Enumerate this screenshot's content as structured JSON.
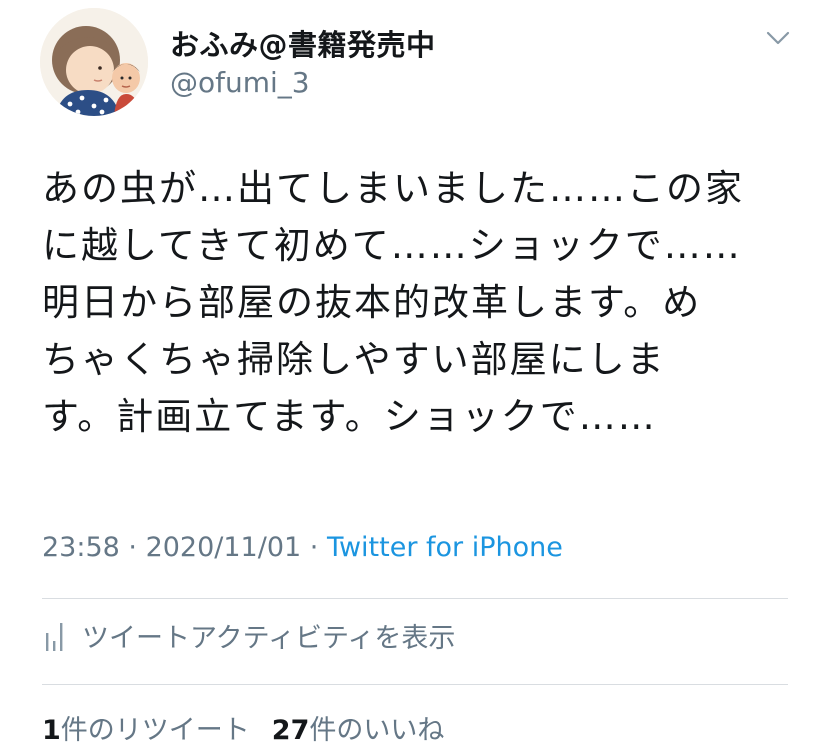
{
  "user": {
    "display_name": "おふみ@書籍発売中",
    "handle": "@ofumi_3"
  },
  "icons": {
    "avatar": "avatar-illustration",
    "menu": "chevron-down-icon",
    "activity": "analytics-bars-icon"
  },
  "tweet": {
    "lines": [
      "あの虫が…出てしまいました……この家",
      "に越してきて初めて……ショックで……",
      "明日から部屋の抜本的改革します。め",
      "ちゃくちゃ掃除しやすい部屋にしま",
      "す。計画立てます。ショックで……"
    ]
  },
  "meta": {
    "time": "23:58",
    "separator": " · ",
    "date": "2020/11/01",
    "source": "Twitter for iPhone"
  },
  "activity": {
    "label": "ツイートアクティビティを表示"
  },
  "counts": {
    "retweets": "1",
    "retweets_label": "件のリツイート",
    "likes": "27",
    "likes_label": "件のいいね"
  },
  "colors": {
    "text": "#14171a",
    "secondary": "#657786",
    "link": "#1b95e0",
    "divider": "#d9dde1"
  }
}
